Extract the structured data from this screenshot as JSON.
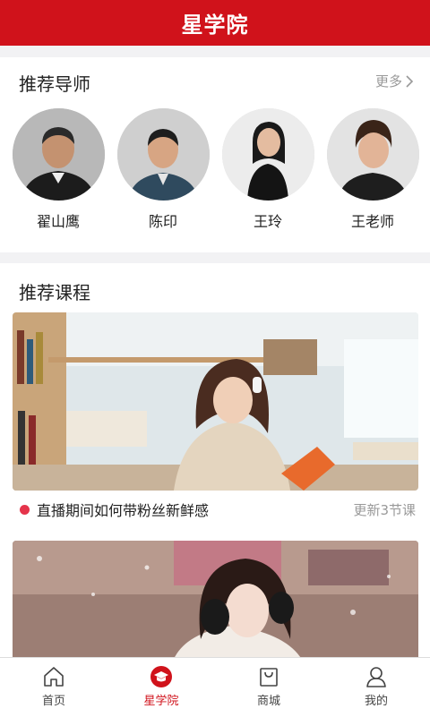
{
  "header": {
    "title": "星学院"
  },
  "mentors": {
    "title": "推荐导师",
    "more_label": "更多",
    "items": [
      {
        "name": "翟山鹰"
      },
      {
        "name": "陈印"
      },
      {
        "name": "王玲"
      },
      {
        "name": "王老师"
      }
    ]
  },
  "courses": {
    "title": "推荐课程",
    "items": [
      {
        "title": "直播期间如何带粉丝新鲜感",
        "update": "更新3节课"
      }
    ]
  },
  "tabbar": {
    "tabs": [
      {
        "label": "首页",
        "icon": "home-icon"
      },
      {
        "label": "星学院",
        "icon": "graduation-cap-icon",
        "active": true
      },
      {
        "label": "商城",
        "icon": "shopping-bag-icon"
      },
      {
        "label": "我的",
        "icon": "user-icon"
      }
    ]
  },
  "colors": {
    "brand": "#d0121b",
    "dot": "#e5344b",
    "muted": "#999999"
  }
}
